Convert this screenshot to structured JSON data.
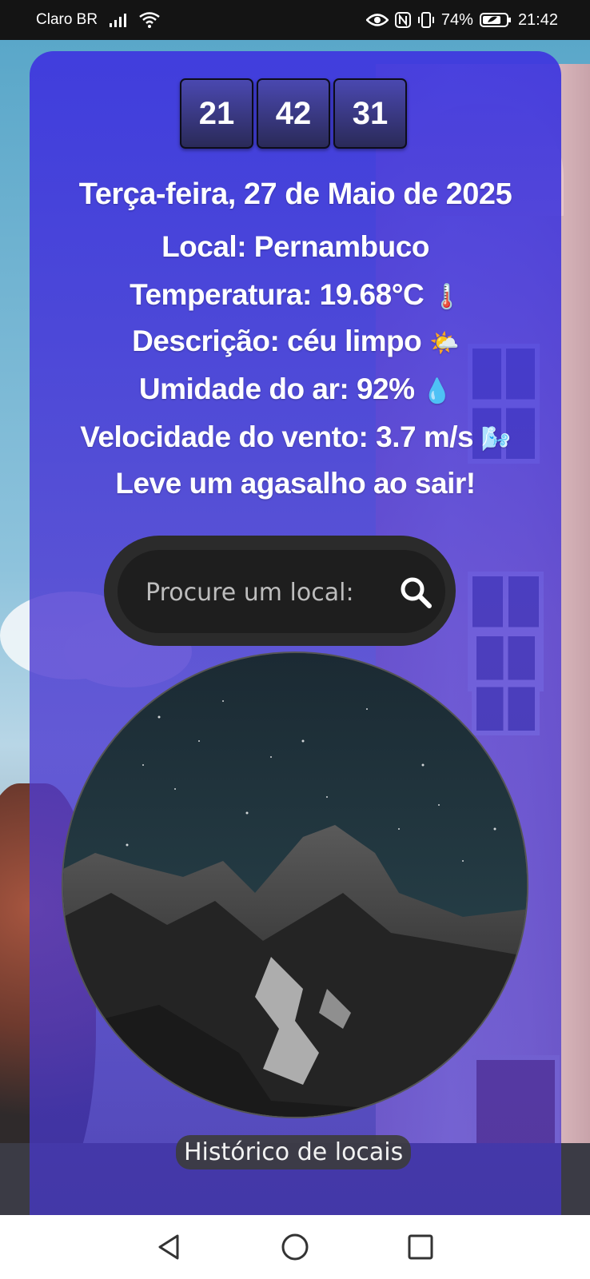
{
  "status_bar": {
    "carrier": "Claro BR",
    "battery": "74%",
    "time": "21:42"
  },
  "clock": {
    "hours": "21",
    "minutes": "42",
    "seconds": "31"
  },
  "date": "Terça-feira, 27 de Maio de 2025",
  "weather": {
    "location": "Local: Pernambuco",
    "temperature": "Temperatura: 19.68°C",
    "temperature_emoji": "🌡️",
    "description": "Descrição: céu limpo",
    "description_emoji": "🌤️",
    "humidity": "Umidade do ar: 92%",
    "humidity_emoji": "💧",
    "wind": "Velocidade do vento: 3.7 m/s",
    "wind_emoji": "🌬️",
    "advice": "Leve um agasalho ao sair!"
  },
  "search": {
    "placeholder": "Procure um local:",
    "icon": "search-icon"
  },
  "history_button": "Histórico de locais",
  "colors": {
    "card": "#3f38de",
    "search_bg": "#1e1e1e",
    "nav_bg": "#ffffff"
  }
}
